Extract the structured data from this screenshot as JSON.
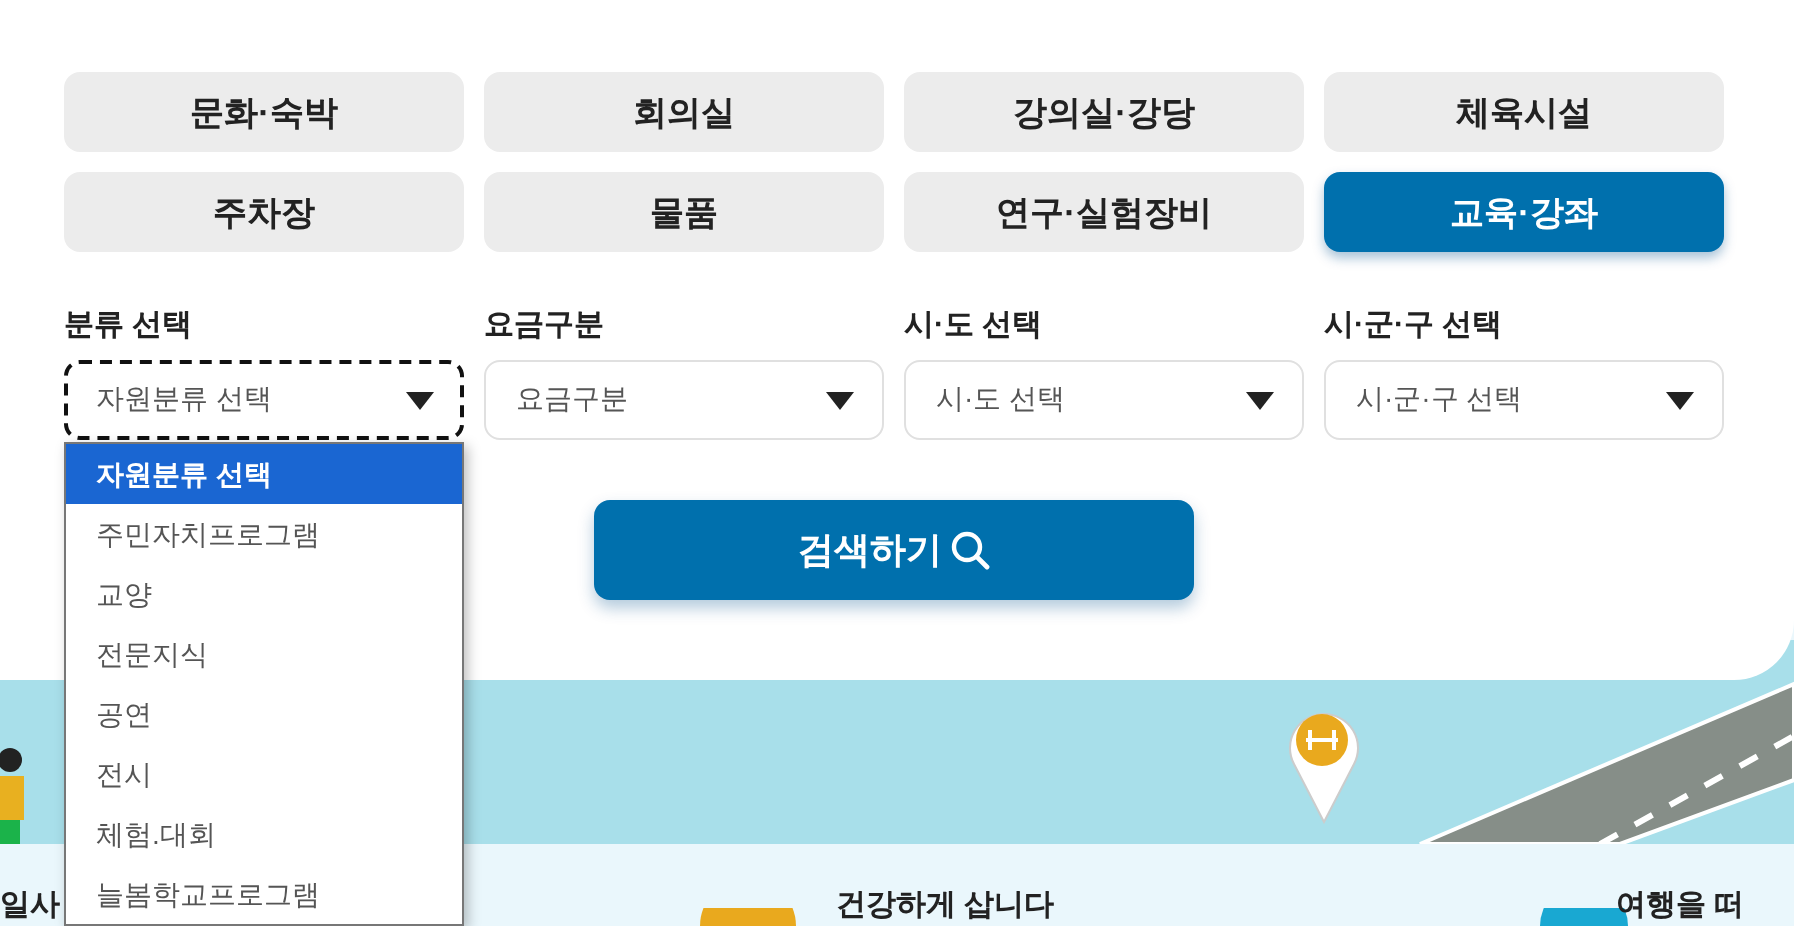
{
  "categories": [
    {
      "label": "문화·숙박",
      "selected": false
    },
    {
      "label": "회의실",
      "selected": false
    },
    {
      "label": "강의실·강당",
      "selected": false
    },
    {
      "label": "체육시설",
      "selected": false
    },
    {
      "label": "주차장",
      "selected": false
    },
    {
      "label": "물품",
      "selected": false
    },
    {
      "label": "연구·실험장비",
      "selected": false
    },
    {
      "label": "교육·강좌",
      "selected": true
    }
  ],
  "filters": [
    {
      "label": "분류 선택",
      "value": "자원분류 선택",
      "focused": true
    },
    {
      "label": "요금구분",
      "value": "요금구분",
      "focused": false
    },
    {
      "label": "시·도 선택",
      "value": "시·도 선택",
      "focused": false
    },
    {
      "label": "시·군·구 선택",
      "value": "시·군·구 선택",
      "focused": false
    }
  ],
  "dropdown": {
    "options": [
      {
        "label": "자원분류 선택",
        "selected": true
      },
      {
        "label": "주민자치프로그램",
        "selected": false
      },
      {
        "label": "교양",
        "selected": false
      },
      {
        "label": "전문지식",
        "selected": false
      },
      {
        "label": "공연",
        "selected": false
      },
      {
        "label": "전시",
        "selected": false
      },
      {
        "label": "체험.대회",
        "selected": false
      },
      {
        "label": "늘봄학교프로그램",
        "selected": false
      }
    ]
  },
  "search_button": {
    "label": "검색하기"
  },
  "cards": [
    {
      "title": "일사"
    },
    {
      "title": "건강하게 삽니다"
    },
    {
      "title": "여행을 떠"
    }
  ]
}
